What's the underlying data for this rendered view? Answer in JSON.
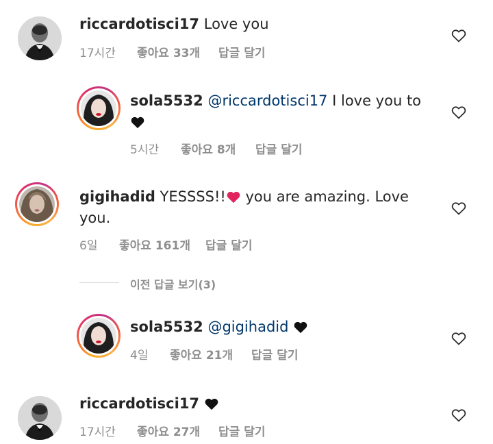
{
  "comments": [
    {
      "username": "riccardotisci17",
      "text": "Love you",
      "time": "17시간",
      "likes": "좋아요 33개",
      "reply": "답글 달기"
    },
    {
      "username": "sola5532",
      "mention": "@riccardotisci17",
      "text": "I love you to",
      "time": "5시간",
      "likes": "좋아요 8개",
      "reply": "답글 달기"
    },
    {
      "username": "gigihadid",
      "text_before": "YESSSS!!",
      "text_after": "you are amazing. Love",
      "text_line2": "you.",
      "time": "6일",
      "likes": "좋아요 161개",
      "reply": "답글 달기"
    },
    {
      "username": "sola5532",
      "mention": "@gigihadid",
      "time": "4일",
      "likes": "좋아요 21개",
      "reply": "답글 달기"
    },
    {
      "username": "riccardotisci17",
      "time": "17시간",
      "likes": "좋아요 27개",
      "reply": "답글 달기"
    }
  ],
  "view_previous_replies": "이전 답글 보기(3)",
  "icons": {
    "like": "heart-outline-icon",
    "emoji_black_heart": "black-heart-icon",
    "emoji_red_heart": "red-heart-icon"
  },
  "colors": {
    "username": "#262626",
    "mention": "#00376b",
    "meta": "#8e8e8e",
    "red_heart": "#e0245e"
  }
}
